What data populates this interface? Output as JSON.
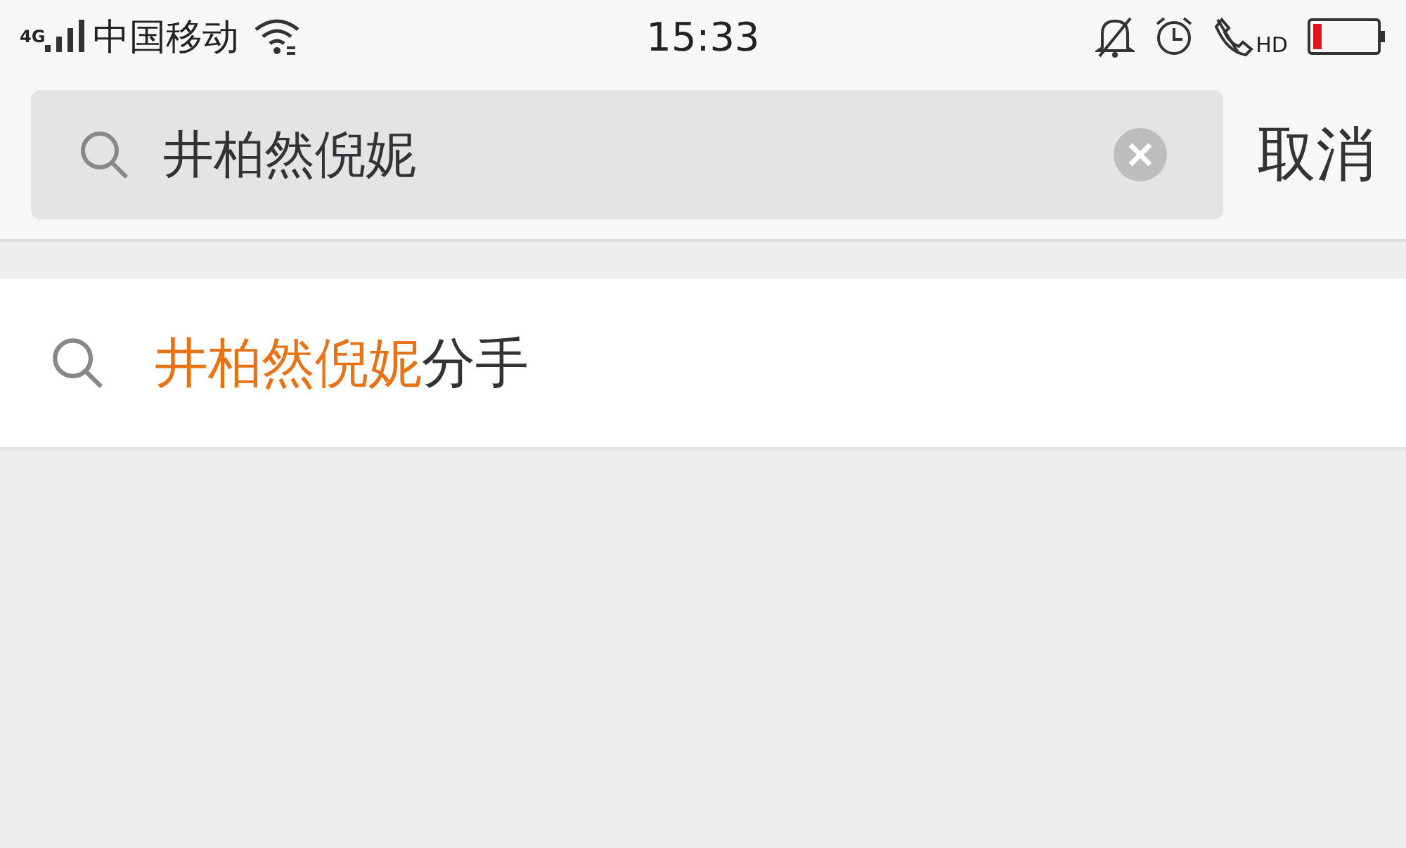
{
  "status_bar": {
    "network": "4G",
    "carrier": "中国移动",
    "time": "15:33",
    "call_badge": "HD"
  },
  "search": {
    "value": "井柏然倪妮",
    "cancel": "取消"
  },
  "suggestions": [
    {
      "match": "井柏然倪妮",
      "rest": "分手"
    }
  ]
}
